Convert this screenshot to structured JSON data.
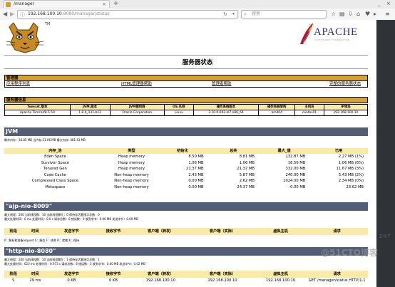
{
  "browser": {
    "tab_title": "/manager",
    "tab_close": "×",
    "new_tab": "+",
    "url_host": "192.168.100.10",
    "url_path": ":8080/manager/status",
    "search_placeholder": "搜索",
    "min_glyph": "_",
    "close_glyph": "×"
  },
  "header": {
    "tm": "TM",
    "apache_brand": "APACHE",
    "apache_sub": "SOFTWARE FOUNDATION",
    "apache_tm": "THE",
    "title": "服务器状态"
  },
  "manager": {
    "section_label": "管理器",
    "links": [
      "应用程序列表",
      "HTML管理器帮助",
      "管理者帮助",
      "完整的服务器状态"
    ]
  },
  "server_info": {
    "section_label": "服务器信息",
    "headers": [
      "Tomcat.版本",
      "JVM.版本",
      "JVM提供商",
      "OS.名称",
      "操作系统版本",
      "操作系统架构",
      "主机名",
      "IP地址"
    ],
    "values": [
      "Apache Tomcat/8.5.50",
      "1.8.0_131-b12",
      "Oracle Corporation",
      "Linux",
      "3.10.0-693.el7.x86_64",
      "amd64",
      "centos01",
      "192.168.100.10"
    ]
  },
  "jvm": {
    "title": "JVM",
    "summary": "剩余内存：18.85 MB 当内存:31.06 MB 最大内存: 481.43 MB",
    "headers": [
      "内存_池",
      "类型",
      "初始化",
      "总共",
      "最大_值",
      "已用"
    ],
    "rows": [
      [
        "Eden Space",
        "Heap memory",
        "8.50 MB",
        "8.81 MB",
        "132.87 MB",
        "2.27 MB (1%)"
      ],
      [
        "Survivor Space",
        "Heap memory",
        "1.06 MB",
        "1.06 MB",
        "16.56 MB",
        "1.06 MB (6%)"
      ],
      [
        "Tenured Gen",
        "Heap memory",
        "21.37 MB",
        "21.37 MB",
        "332.00 MB",
        "11.67 MB (3%)"
      ],
      [
        "Code Cache",
        "Non-heap memory",
        "2.43 MB",
        "5.87 MB",
        "240.00 MB",
        "5.43 MB (2%)"
      ],
      [
        "Compressed Class Space",
        "Non-heap memory",
        "0.00 MB",
        "2.62 MB",
        "1024.00 MB",
        "2.34 MB (0%)"
      ],
      [
        "Metaspace",
        "Non-heap memory",
        "0.00 MB",
        "24.37 MB",
        "-0.00 MB",
        "23.62 MB"
      ]
    ]
  },
  "ajp": {
    "title": "\"ajp-nio-8009\"",
    "line1": "最大线程：200 当前线程数：10 当前线程繁忙：0 保持存活套接字总数：0",
    "line2": "最大处理时间：0 ms 处理时间：0.0 s 请求总数：0 错误数：0 收到字节：0.00 MB 发送字节：0.00 MB",
    "headers": [
      "阶段",
      "时间",
      "发送字节",
      "接收字节",
      "客户端（转发）",
      "客户端（实际）",
      "虚拟主机",
      "请求"
    ],
    "legend": "P：解析和准备request S：服务 F：结束 R：就绪 K：保持"
  },
  "http": {
    "title": "\"http-nio-8080\"",
    "line1": "最大线程：200 当前线程数：10 当前线程繁忙：1 保持存活套接字总数：1",
    "line2": "最大处理时间：623 ms 处理时间：0.973 s 请求总数：6 错误数：3 收到字节：0.00 MB 发送字节：0.02 MB",
    "headers": [
      "阶段",
      "时间",
      "发送字节",
      "接收字节",
      "客户端（转发）",
      "客户端（实际）",
      "虚拟主机",
      "请求"
    ],
    "row": [
      "S",
      "29 ms",
      "0 KB",
      "0 KB",
      "192.168.100.10",
      "192.168.100.10",
      "192.168.100.10",
      "GET /manager/status HTTP/1.1"
    ]
  },
  "desktop": {
    "side_text": "ENT",
    "watermark": "@51CTO博客"
  }
}
